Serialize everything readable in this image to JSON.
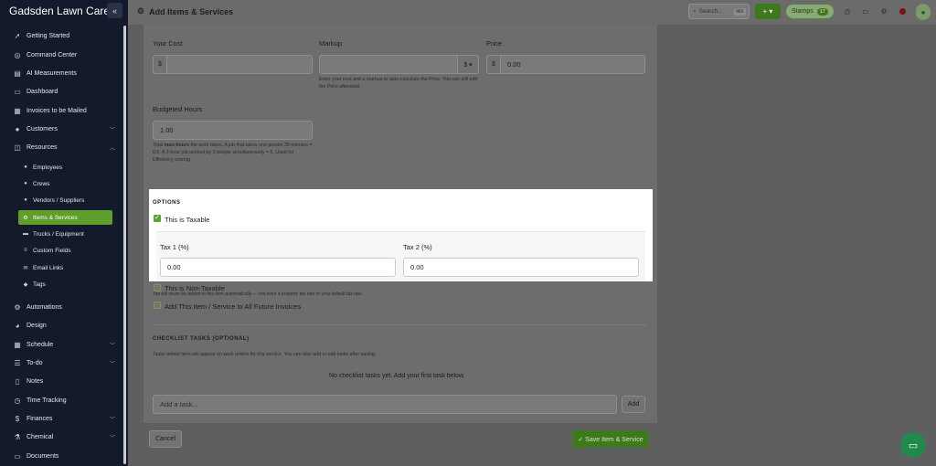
{
  "app": {
    "brand": "Gadsden Lawn Care"
  },
  "sidebar": {
    "items": [
      {
        "label": "Getting Started",
        "icon": "rocket-icon"
      },
      {
        "label": "Command Center",
        "icon": "gauge-icon"
      },
      {
        "label": "AI Measurements",
        "icon": "ruler-icon"
      },
      {
        "label": "Dashboard",
        "icon": "monitor-icon"
      },
      {
        "label": "Invoices to be Mailed",
        "icon": "mail-icon"
      },
      {
        "label": "Customers",
        "icon": "users-icon"
      },
      {
        "label": "Resources",
        "icon": "box-icon"
      }
    ],
    "resources_sub": [
      {
        "label": "Employees",
        "icon": "user-icon"
      },
      {
        "label": "Crews",
        "icon": "users-icon"
      },
      {
        "label": "Vendors / Suppliers",
        "icon": "user-icon"
      },
      {
        "label": "Items & Services",
        "icon": "gears-icon"
      },
      {
        "label": "Trucks / Equipment",
        "icon": "truck-icon"
      },
      {
        "label": "Custom Fields",
        "icon": "list-icon"
      },
      {
        "label": "Email Links",
        "icon": "envelope-icon"
      },
      {
        "label": "Tags",
        "icon": "tag-icon"
      }
    ],
    "items_bottom": [
      {
        "label": "Automations",
        "icon": "gears-icon"
      },
      {
        "label": "Design",
        "icon": "palette-icon"
      },
      {
        "label": "Schedule",
        "icon": "calendar-icon"
      },
      {
        "label": "To-do",
        "icon": "list-icon"
      },
      {
        "label": "Notes",
        "icon": "note-icon"
      },
      {
        "label": "Time Tracking",
        "icon": "clock-icon"
      },
      {
        "label": "Finances",
        "icon": "dollar-icon"
      },
      {
        "label": "Chemical",
        "icon": "flask-icon"
      },
      {
        "label": "Documents",
        "icon": "file-icon"
      }
    ]
  },
  "topbar": {
    "title": "Add Items & Services",
    "search_placeholder": "Search...",
    "search_shortcut": "⌘K",
    "add_label": "+ ▾",
    "stamps_label": "Stamps",
    "stamps_count": "17"
  },
  "form": {
    "your_cost_label": "Your Cost",
    "markup_label": "Markup",
    "price_label": "Price",
    "currency_symbol": "$",
    "markup_unit": "$ ▾",
    "price_value": "0.00",
    "price_help": "Enter your cost and a markup to auto-calculate the Price. You can still edit the Price afterward.",
    "budgeted_hours_label": "Budgeted Hours",
    "budgeted_hours_value": "1.00",
    "budgeted_help_1": "Total ",
    "budgeted_help_bold": "man-hours",
    "budgeted_help_2": " the work takes. A job that takes one person 30 minutes = 0.5. A 2-hour job worked by 3 people simultaneously = 6. Used for Efficiency scoring.",
    "options_heading": "OPTIONS",
    "taxable_label": "This is Taxable",
    "tax1_label": "Tax 1 (%)",
    "tax1_value": "0.00",
    "tax2_label": "Tax 2 (%)",
    "tax2_value": "0.00",
    "non_taxable_label": "This is Non-Taxable",
    "non_taxable_help": "Tax will never be added to this item automatically — not even a property tax rate or your default tax rate.",
    "future_invoices_label": "Add This Item / Service to All Future Invoices",
    "checklist_heading": "CHECKLIST TASKS (OPTIONAL)",
    "checklist_help": "Tasks added here will appear on work orders for this service. You can also add or edit tasks after saving.",
    "checklist_empty": "No checklist tasks yet. Add your first task below.",
    "task_placeholder": "Add a task...",
    "add_task_label": "Add",
    "cancel_label": "Cancel",
    "save_label": "✓  Save Item & Service"
  }
}
